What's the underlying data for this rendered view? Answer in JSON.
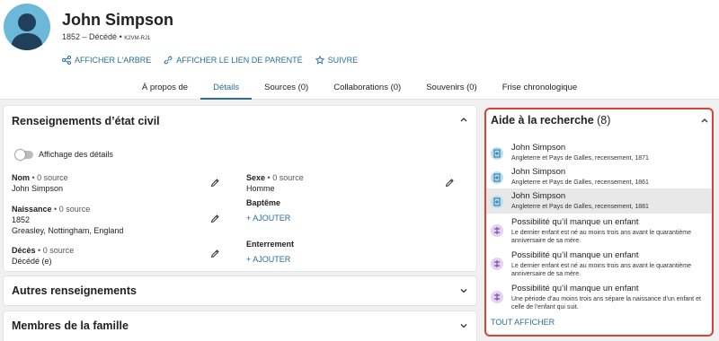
{
  "person": {
    "name": "John Simpson",
    "lifespan": "1852 – Décédé",
    "separator": "•",
    "pid": "K2VM-RJ1"
  },
  "actions": [
    {
      "label": "AFFICHER L'ARBRE",
      "icon": "tree-icon"
    },
    {
      "label": "AFFICHER LE LIEN DE PARENTÉ",
      "icon": "link-icon"
    },
    {
      "label": "SUIVRE",
      "icon": "star-icon"
    }
  ],
  "tabs": [
    {
      "label": "À propos de"
    },
    {
      "label": "Détails",
      "active": true
    },
    {
      "label": "Sources (0)"
    },
    {
      "label": "Collaborations (0)"
    },
    {
      "label": "Souvenirs (0)"
    },
    {
      "label": "Frise chronologique"
    }
  ],
  "vitals": {
    "title": "Renseignements d’état civil",
    "toggle_label": "Affichage des détails",
    "name": {
      "label": "Nom",
      "sources": "• 0 source",
      "value": "John Simpson"
    },
    "birth": {
      "label": "Naissance",
      "sources": "• 0 source",
      "date": "1852",
      "place": "Greasley, Nottingham, England"
    },
    "death": {
      "label": "Décès",
      "sources": "• 0 source",
      "value": "Décédé (e)"
    },
    "sex": {
      "label": "Sexe",
      "sources": "• 0 source",
      "value": "Homme"
    },
    "baptism": {
      "label": "Baptême",
      "add": "+ AJOUTER"
    },
    "burial": {
      "label": "Enterrement",
      "add": "+ AJOUTER"
    }
  },
  "other": {
    "title": "Autres renseignements"
  },
  "family": {
    "title": "Membres de la famille"
  },
  "research": {
    "title": "Aide à la recherche",
    "count": "(8)",
    "items": [
      {
        "name": "John Simpson",
        "desc": "Angleterre et Pays de Galles, recensement, 1871",
        "type": "record"
      },
      {
        "name": "John Simpson",
        "desc": "Angleterre et Pays de Galles, recensement, 1861",
        "type": "record"
      },
      {
        "name": "John Simpson",
        "desc": "Angleterre et Pays de Galles, recensement, 1881",
        "type": "record"
      },
      {
        "name": "Possibilité qu’il manque un enfant",
        "desc": "Le dernier enfant est né au moins trois ans avant le quarantième anniversaire de sa mère.",
        "type": "hint"
      },
      {
        "name": "Possibilité qu’il manque un enfant",
        "desc": "Le dernier enfant est né au moins trois ans avant le quarantième anniversaire de sa mère.",
        "type": "hint"
      },
      {
        "name": "Possibilité qu’il manque un enfant",
        "desc": "Une période d’au moins trois ans sépare la naissance d’un enfant et celle de l’enfant qui suit.",
        "type": "hint"
      }
    ],
    "show_all": "TOUT AFFICHER"
  },
  "colors": {
    "accent": "#2a6f97",
    "highlight_border": "#d9423a",
    "avatar": "#6bb8d9"
  }
}
